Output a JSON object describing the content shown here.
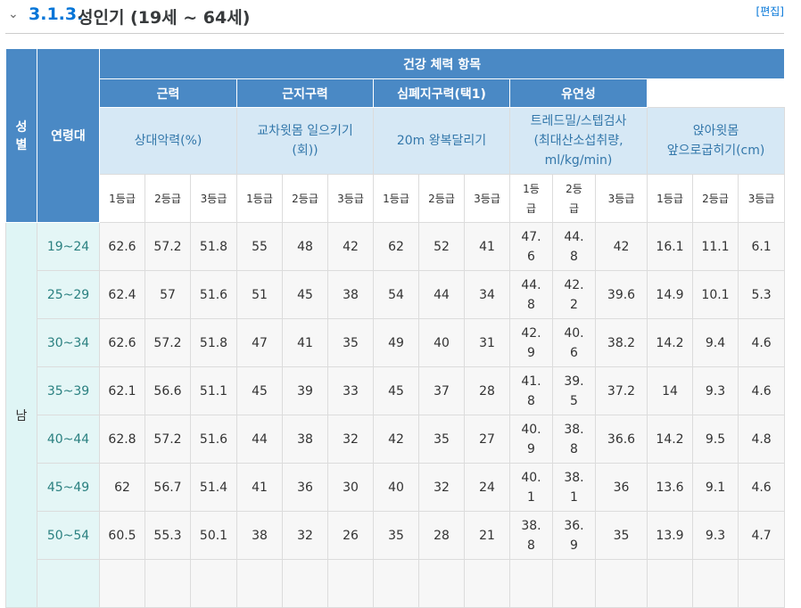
{
  "heading": {
    "section_number": "3.1.3.",
    "section_title": "성인기 (19세 ~ 64세)",
    "edit_label": "[편집]"
  },
  "table": {
    "col_sex": "성\n별",
    "col_age": "연령대",
    "group_header": "건강 체력 항목",
    "categories": [
      "근력",
      "근지구력",
      "심폐지구력(택1)",
      "유연성"
    ],
    "items": [
      "상대악력(%)",
      "교차윗몸 일으키기\n(회))",
      "20m 왕복달리기",
      "트레드밀/스텝검사\n(최대산소섭취량,\nml/kg/min)",
      "앉아윗몸\n앞으로굽히기(cm)"
    ],
    "grades": [
      "1등급",
      "2등급",
      "3등급",
      "1등급",
      "2등급",
      "3등급",
      "1등급",
      "2등급",
      "3등급",
      "1등\n급",
      "2등\n급",
      "3등급",
      "1등급",
      "2등급",
      "3등급"
    ],
    "sex_value": "남",
    "rows": [
      {
        "age": "19~24",
        "cells": [
          "62.6",
          "57.2",
          "51.8",
          "55",
          "48",
          "42",
          "62",
          "52",
          "41",
          "47.\n6",
          "44.\n8",
          "42",
          "16.1",
          "11.1",
          "6.1"
        ]
      },
      {
        "age": "25~29",
        "cells": [
          "62.4",
          "57",
          "51.6",
          "51",
          "45",
          "38",
          "54",
          "44",
          "34",
          "44.\n8",
          "42.\n2",
          "39.6",
          "14.9",
          "10.1",
          "5.3"
        ]
      },
      {
        "age": "30~34",
        "cells": [
          "62.6",
          "57.2",
          "51.8",
          "47",
          "41",
          "35",
          "49",
          "40",
          "31",
          "42.\n9",
          "40.\n6",
          "38.2",
          "14.2",
          "9.4",
          "4.6"
        ]
      },
      {
        "age": "35~39",
        "cells": [
          "62.1",
          "56.6",
          "51.1",
          "45",
          "39",
          "33",
          "45",
          "37",
          "28",
          "41.\n8",
          "39.\n5",
          "37.2",
          "14",
          "9.3",
          "4.6"
        ]
      },
      {
        "age": "40~44",
        "cells": [
          "62.8",
          "57.2",
          "51.6",
          "44",
          "38",
          "32",
          "42",
          "35",
          "27",
          "40.\n9",
          "38.\n8",
          "36.6",
          "14.2",
          "9.5",
          "4.8"
        ]
      },
      {
        "age": "45~49",
        "cells": [
          "62",
          "56.7",
          "51.4",
          "41",
          "36",
          "30",
          "40",
          "32",
          "24",
          "40.\n1",
          "38.\n1",
          "36",
          "13.6",
          "9.1",
          "4.6"
        ]
      },
      {
        "age": "50~54",
        "cells": [
          "60.5",
          "55.3",
          "50.1",
          "38",
          "32",
          "26",
          "35",
          "28",
          "21",
          "38.\n8",
          "36.\n9",
          "35",
          "13.9",
          "9.3",
          "4.7"
        ]
      },
      {
        "age": "",
        "cells": [
          "",
          "",
          "",
          "",
          "",
          "",
          "",
          "",
          "",
          "",
          "",
          "",
          "",
          "",
          ""
        ]
      }
    ]
  }
}
